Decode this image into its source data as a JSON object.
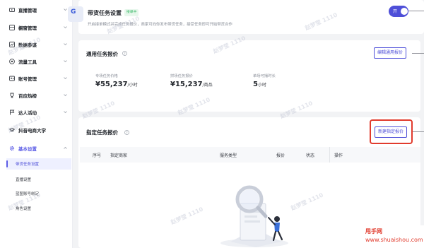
{
  "sidebar": {
    "items": [
      {
        "label": "直播管理",
        "icon": "tv-icon"
      },
      {
        "label": "橱窗管理",
        "icon": "showcase-icon"
      },
      {
        "label": "数据参谋",
        "icon": "chart-icon"
      },
      {
        "label": "流量工具",
        "icon": "traffic-icon"
      },
      {
        "label": "账号管理",
        "icon": "account-icon"
      },
      {
        "label": "百应热榜",
        "icon": "trophy-icon"
      },
      {
        "label": "达人活动",
        "icon": "flag-icon"
      },
      {
        "label": "抖音电商大学",
        "icon": "graduation-cap-icon"
      },
      {
        "label": "基本设置",
        "icon": "gear-icon"
      }
    ],
    "sub_items": [
      {
        "label": "带货任务设置",
        "active": true
      },
      {
        "label": "直播设置",
        "active": false
      },
      {
        "label": "蓝图账号绑定",
        "active": false
      },
      {
        "label": "角色设置",
        "active": false
      }
    ]
  },
  "header": {
    "logo_glyph": "G",
    "title": "带货任务设置",
    "status_badge": "接单中",
    "description": "开启接单模式并完成任务报价，商家可向你发布带货任务，接受任务即可开始带货合作",
    "toggle_label": "开"
  },
  "general_quote": {
    "title": "通用任务报价",
    "edit_button": "编辑通用报价",
    "metrics": [
      {
        "label": "专场任务价格",
        "value": "¥55,237",
        "unit": "/小时"
      },
      {
        "label": "拼场任务报价",
        "value": "¥15,237",
        "unit": "/商品"
      },
      {
        "label": "单场可播时长",
        "value": "5",
        "unit": "小时"
      }
    ]
  },
  "assigned_quote": {
    "title": "指定任务报价",
    "new_button": "新建指定报价",
    "columns": [
      "序号",
      "指定商家",
      "服务类型",
      "报价",
      "状态",
      "操作"
    ]
  },
  "watermark_text": "赵梦莹 1110",
  "site_badge": {
    "line1": "甩手网",
    "line2": "www.shuaishou.com"
  },
  "colors": {
    "accent": "#4e4fd8",
    "highlight": "#e13b2d",
    "success": "#2fb55f"
  }
}
